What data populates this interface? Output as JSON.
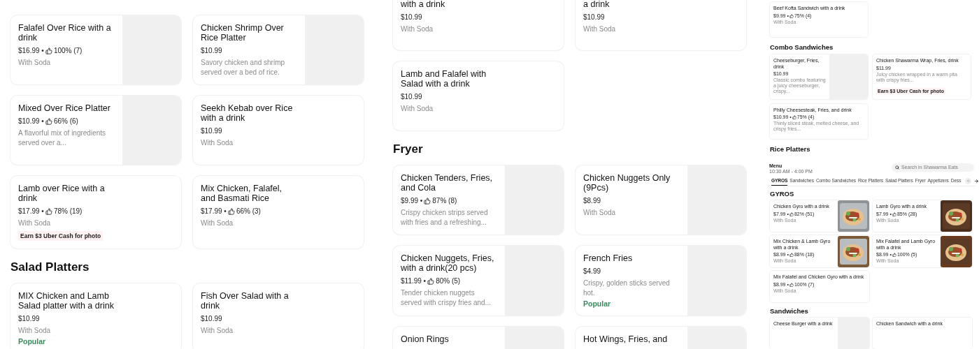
{
  "panels": [
    {
      "sections": [
        {
          "items": [
            {
              "title": "Falafel Over Rice with a drink",
              "price": "$16.99 •",
              "rating": "100% (7)",
              "description": "With Soda",
              "image_placeholder": true
            },
            {
              "title": "Chicken Shrimp Over Rice Platter",
              "price": "$10.99",
              "description": "Savory chicken and shrimp served over a bed of rice.",
              "image_placeholder": true
            },
            {
              "title": "Mixed Over Rice Platter",
              "price": "$10.99 •",
              "rating": "66% (6)",
              "description": "A flavorful mix of ingredients served over a...",
              "image_placeholder": true
            },
            {
              "title": "Seekh Kebab over Rice with a drink",
              "price": "$10.99",
              "description": "With Soda"
            },
            {
              "title": "Lamb over Rice with a drink",
              "price": "$17.99 •",
              "rating": "78% (19)",
              "description": "With Soda",
              "promo": "Earn $3 Uber Cash for photo"
            },
            {
              "title": "Mix Chicken, Falafel, and Basmati Rice",
              "price": "$17.99 •",
              "rating": "66% (3)",
              "description": "With Soda"
            }
          ]
        },
        {
          "heading": "Salad Platters",
          "items": [
            {
              "title": "MIX Chicken and Lamb Salad platter with a drink",
              "price": "$10.99",
              "description": "With Soda",
              "tag": "Popular"
            },
            {
              "title": "Fish Over Salad with a drink",
              "price": "$10.99",
              "description": "With Soda"
            }
          ]
        }
      ]
    },
    {
      "sections": [
        {
          "items": [
            {
              "title": "with a drink",
              "price": "$10.99",
              "description": "With Soda"
            },
            {
              "title": "a drink",
              "price": "$10.99",
              "description": "With Soda"
            },
            {
              "title": "Lamb and Falafel with Salad with a drink",
              "price": "$10.99",
              "description": "With Soda"
            }
          ]
        },
        {
          "heading": "Fryer",
          "items": [
            {
              "title": "Chicken Tenders, Fries, and Cola",
              "price": "$9.99 •",
              "rating": "87% (8)",
              "description": "Crispy chicken strips served with fries and a refreshing...",
              "image_placeholder": true
            },
            {
              "title": "Chicken Nuggets Only (9Pcs)",
              "price": "$8.99",
              "description": "With Soda",
              "image_placeholder": true
            },
            {
              "title": "Chicken Nuggets, Fries, with a drink(20 pcs)",
              "price": "$11.99 •",
              "rating": "80% (5)",
              "description": "Tender chicken nuggets served with crispy fries and...",
              "image_placeholder": true
            },
            {
              "title": "French Fries",
              "price": "$4.99",
              "description": "Crispy, golden sticks served hot.",
              "tag": "Popular",
              "image_placeholder": true
            },
            {
              "title": "Onion Rings",
              "image_placeholder": true
            },
            {
              "title": "Hot Wings, Fries, and",
              "image_placeholder": true
            }
          ]
        }
      ]
    }
  ],
  "preview": {
    "sections": [
      {
        "items": [
          {
            "title": "Beef Kofta Sandwich with a drink",
            "price": "$9.99 •",
            "rating": "75% (4)",
            "description": "With Soda"
          }
        ]
      },
      {
        "heading": "Combo Sandwiches",
        "items": [
          {
            "title": "Cheeseburger, Fries, drink",
            "price": "$10.99",
            "description": "Classic combo featuring a juicy cheeseburger, crispy...",
            "image_placeholder": true
          },
          {
            "title": "Chicken Shawarma Wrap, Fries, drink",
            "price": "$11.99",
            "description": "Juicy chicken wrapped in a warm pita with crispy fries...",
            "promo": "Earn $3 Uber Cash for photo"
          },
          {
            "title": "Philly Cheesesteak, Fries, and drink",
            "price": "$10.99 •",
            "rating": "75% (4)",
            "description": "Thinly sliced steak, melted cheese, and crispy fries..."
          }
        ]
      },
      {
        "heading": "Rice Platters"
      }
    ],
    "menu_bar": {
      "title": "Menu",
      "hours": "10:30 AM - 4:00 PM",
      "search": {
        "placeholder": "Search in Shawarma Eats"
      },
      "tabs": [
        {
          "label": "GYROS",
          "selected": true
        },
        {
          "label": "Sandwiches",
          "selected": false
        },
        {
          "label": "Combo Sandwiches",
          "selected": false
        },
        {
          "label": "Rice Platters",
          "selected": false
        },
        {
          "label": "Salad Platters",
          "selected": false
        },
        {
          "label": "Fryer",
          "selected": false
        },
        {
          "label": "Appetizers",
          "selected": false
        },
        {
          "label": "Dess",
          "selected": false
        }
      ]
    },
    "lower_sections": [
      {
        "heading": "GYROS",
        "items": [
          {
            "title": "Chicken Gyro with a drink",
            "price": "$7.99 •",
            "rating": "82% (51)",
            "description": "With Soda",
            "photo": true
          },
          {
            "title": "Lamb Gyro with a drink",
            "price": "$7.99 •",
            "rating": "85% (28)",
            "description": "With Soda",
            "photo": true
          },
          {
            "title": "Mix Chicken & Lamb Gyro with a drink",
            "price": "$8.99 •",
            "rating": "88% (18)",
            "description": "With Soda",
            "photo": true
          },
          {
            "title": "Mix Falafel and Lamb Gyro with a drink",
            "price": "$8.99 •",
            "rating": "100% (5)",
            "description": "With Soda",
            "photo": true
          },
          {
            "title": "Mix Falafel and Chicken Gyro with a drink",
            "price": "$8.99 •",
            "rating": "100% (7)",
            "description": "With Soda"
          }
        ]
      },
      {
        "heading": "Sandwiches",
        "items": [
          {
            "title": "Cheese Burger with a drink",
            "image_placeholder": true
          },
          {
            "title": "Chicken Sandwich with a drink"
          }
        ]
      }
    ]
  }
}
